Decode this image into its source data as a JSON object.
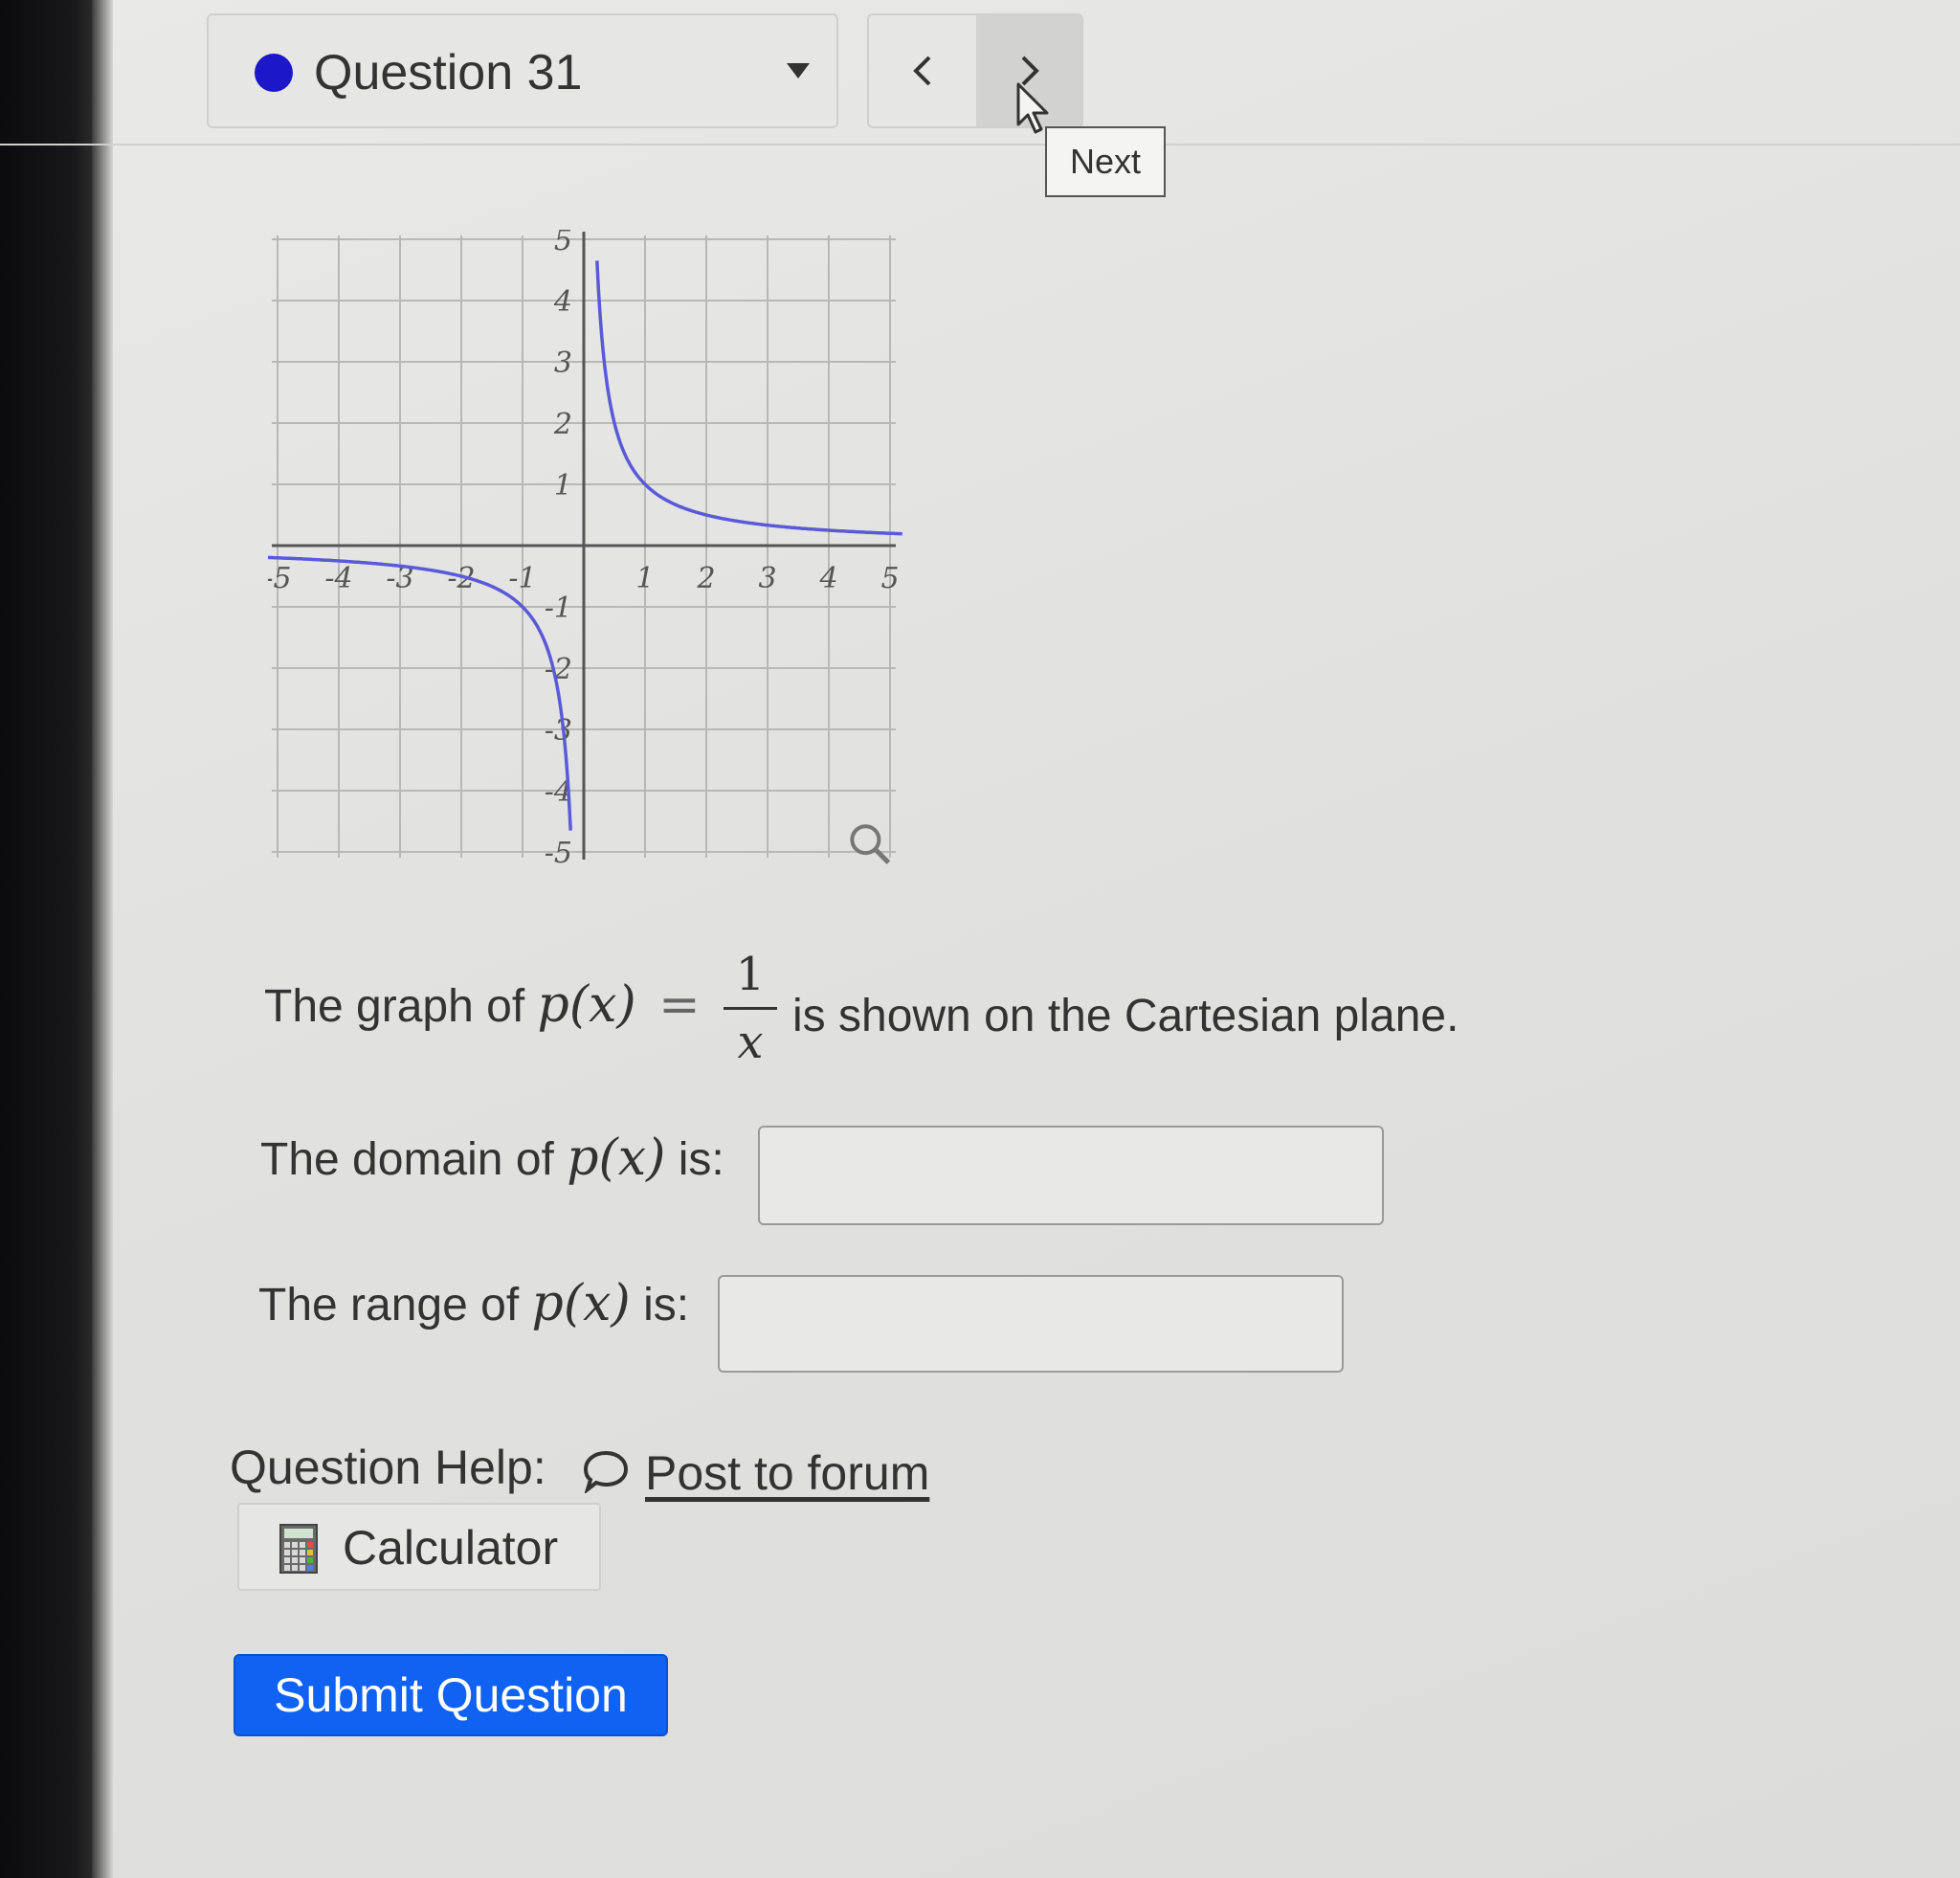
{
  "header": {
    "question_title": "Question 31",
    "tooltip": "Next",
    "status_color": "#1c18c8"
  },
  "graph": {
    "x_ticks": [
      "-5",
      "-4",
      "-3",
      "-2",
      "-1",
      "1",
      "2",
      "3",
      "4",
      "5"
    ],
    "y_ticks": [
      "5",
      "4",
      "3",
      "2",
      "1",
      "-1",
      "-2",
      "-3",
      "-4",
      "-5"
    ],
    "xlim": [
      -5,
      5
    ],
    "ylim": [
      -5,
      5
    ],
    "curve_color": "#5a5ad8",
    "function": "1/x",
    "zoom_icon": "magnifier-icon"
  },
  "question": {
    "intro_prefix": "The graph of",
    "func_name": "p(x)",
    "equals": "=",
    "frac_num": "1",
    "frac_den": "x",
    "intro_suffix": "is shown on the Cartesian plane.",
    "domain_prefix": "The domain of",
    "domain_suffix": "is:",
    "range_prefix": "The range of",
    "range_suffix": "is:",
    "domain_value": "",
    "range_value": ""
  },
  "help": {
    "label": "Question Help:",
    "forum_link": "Post to forum",
    "calculator": "Calculator"
  },
  "actions": {
    "submit": "Submit Question",
    "submit_color": "#0f62f2"
  }
}
